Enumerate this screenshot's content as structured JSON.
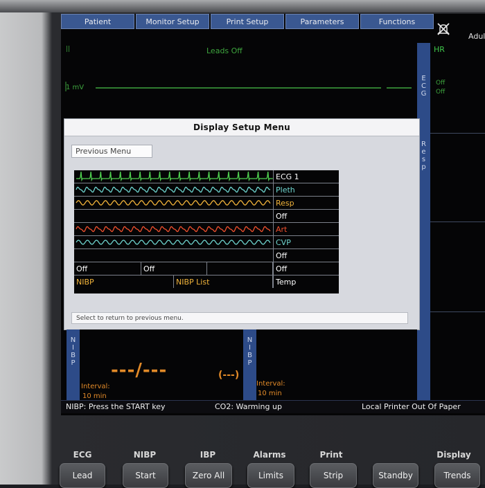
{
  "tabs": [
    "Patient",
    "Monitor Setup",
    "Print Setup",
    "Parameters",
    "Functions"
  ],
  "header": {
    "patient_type": "Adul"
  },
  "ecg_strip": {
    "leads_status": "Leads Off",
    "scale_label": "1 mV",
    "marker": "||"
  },
  "side_labels": {
    "ecg": [
      "E",
      "C",
      "G"
    ],
    "resp": [
      "R",
      "e",
      "s",
      "p"
    ],
    "nibp": [
      "N",
      "I",
      "B",
      "P"
    ]
  },
  "hr": {
    "label": "HR",
    "off_lines": [
      "Off",
      "Off"
    ]
  },
  "dialog": {
    "title": "Display Setup Menu",
    "previous_menu": "Previous Menu",
    "status": "Select to return to previous menu.",
    "waveform_rows": [
      {
        "label": "ECG 1",
        "label_color": "#ffffff",
        "wave": "ecg",
        "wave_color": "#4fcf4f"
      },
      {
        "label": "Pleth",
        "label_color": "#6fd6d0",
        "wave": "pleth",
        "wave_color": "#6fd6d0"
      },
      {
        "label": "Resp",
        "label_color": "#f2b43a",
        "wave": "resp",
        "wave_color": "#f2b43a"
      },
      {
        "label": "Off",
        "label_color": "#ffffff",
        "wave": "none",
        "wave_color": "#000000"
      },
      {
        "label": "Art",
        "label_color": "#f0502e",
        "wave": "art",
        "wave_color": "#f0502e"
      },
      {
        "label": "CVP",
        "label_color": "#6fd6d0",
        "wave": "cvp",
        "wave_color": "#6fd6d0"
      },
      {
        "label": "Off",
        "label_color": "#ffffff",
        "wave": "none",
        "wave_color": "#000000"
      }
    ],
    "split_row": {
      "cells": [
        "Off",
        "Off",
        ""
      ],
      "right": "Off"
    },
    "nibp_row": {
      "cells": [
        "NIBP",
        "NIBP List"
      ],
      "right": "Temp",
      "color": "#f2b43a"
    }
  },
  "nibp": {
    "left_value": "---/---",
    "left_mean": "(---)",
    "interval_label": "Interval:",
    "interval_value": "10 min",
    "right_interval_label": "Interval:",
    "right_interval_value": "10 min"
  },
  "status_bar": {
    "left": "NIBP: Press the START key",
    "middle": "CO2: Warming up",
    "right": "Local Printer Out Of Paper"
  },
  "hardware_keys": [
    {
      "group": "ECG",
      "button": "Lead"
    },
    {
      "group": "NIBP",
      "button": "Start"
    },
    {
      "group": "IBP",
      "button": "Zero All"
    },
    {
      "group": "Alarms",
      "button": "Limits"
    },
    {
      "group": "Print",
      "button": "Strip"
    },
    {
      "group": "",
      "button": "Standby"
    },
    {
      "group": "Display",
      "button": "Trends"
    }
  ],
  "colors": {
    "tab_bg": "#3a5891",
    "side_strip": "#2d4b88",
    "ecg_green": "#3ea53e",
    "nibp_orange": "#e28a28"
  }
}
